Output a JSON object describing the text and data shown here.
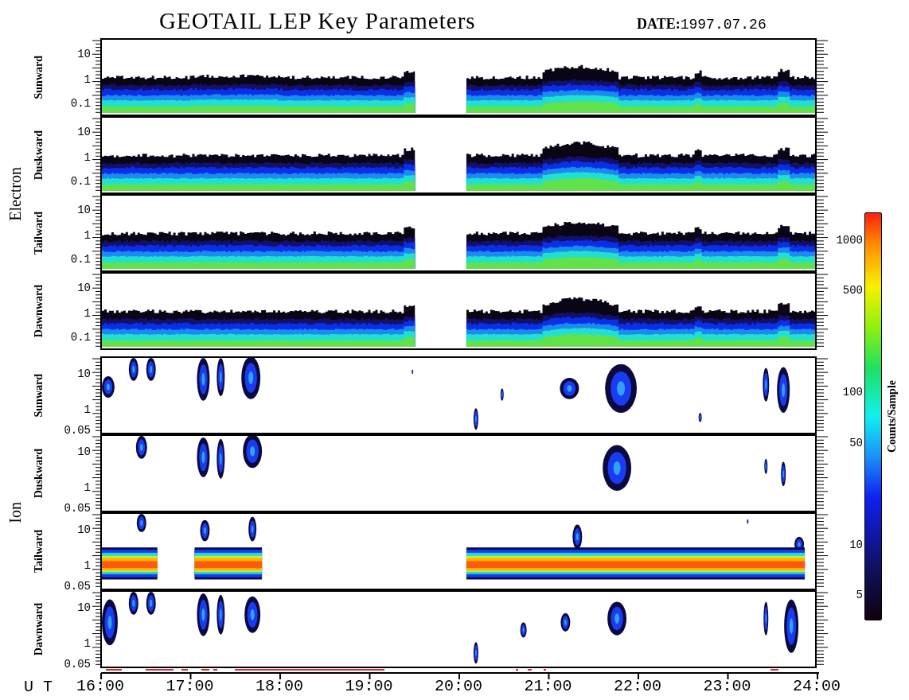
{
  "title": "GEOTAIL LEP Key Parameters",
  "date": {
    "label": "DATE:",
    "value": "1997.07.26"
  },
  "groups": [
    {
      "name": "Electron",
      "panels": [
        {
          "direction": "Sunward",
          "kind": "band",
          "yticks": [
            "10",
            "1",
            "0.1"
          ]
        },
        {
          "direction": "Duskward",
          "kind": "band",
          "yticks": [
            "10",
            "1",
            "0.1"
          ]
        },
        {
          "direction": "Tailward",
          "kind": "band",
          "yticks": [
            "10",
            "1",
            "0.1"
          ]
        },
        {
          "direction": "Dawnward",
          "kind": "band",
          "yticks": [
            "10",
            "1",
            "0.1"
          ]
        }
      ]
    },
    {
      "name": "Ion",
      "panels": [
        {
          "direction": "Sunward",
          "kind": "patches",
          "yticks": [
            "10",
            "1",
            "0.05"
          ]
        },
        {
          "direction": "Duskward",
          "kind": "patches",
          "yticks": [
            "10",
            "1",
            "0.05"
          ]
        },
        {
          "direction": "Tailward",
          "kind": "beam",
          "yticks": [
            "10",
            "1",
            "0.05"
          ]
        },
        {
          "direction": "Dawnward",
          "kind": "patches",
          "yticks": [
            "10",
            "1",
            "0.05"
          ]
        }
      ]
    }
  ],
  "time_axis": {
    "label": "U T",
    "ticks": [
      "16:00",
      "17:00",
      "18:00",
      "19:00",
      "20:00",
      "21:00",
      "22:00",
      "23:00",
      "24:00"
    ]
  },
  "colorbar": {
    "title": "Counts/Sample",
    "ticks": [
      "1000",
      "500",
      "100",
      "50",
      "10",
      "5"
    ]
  }
}
